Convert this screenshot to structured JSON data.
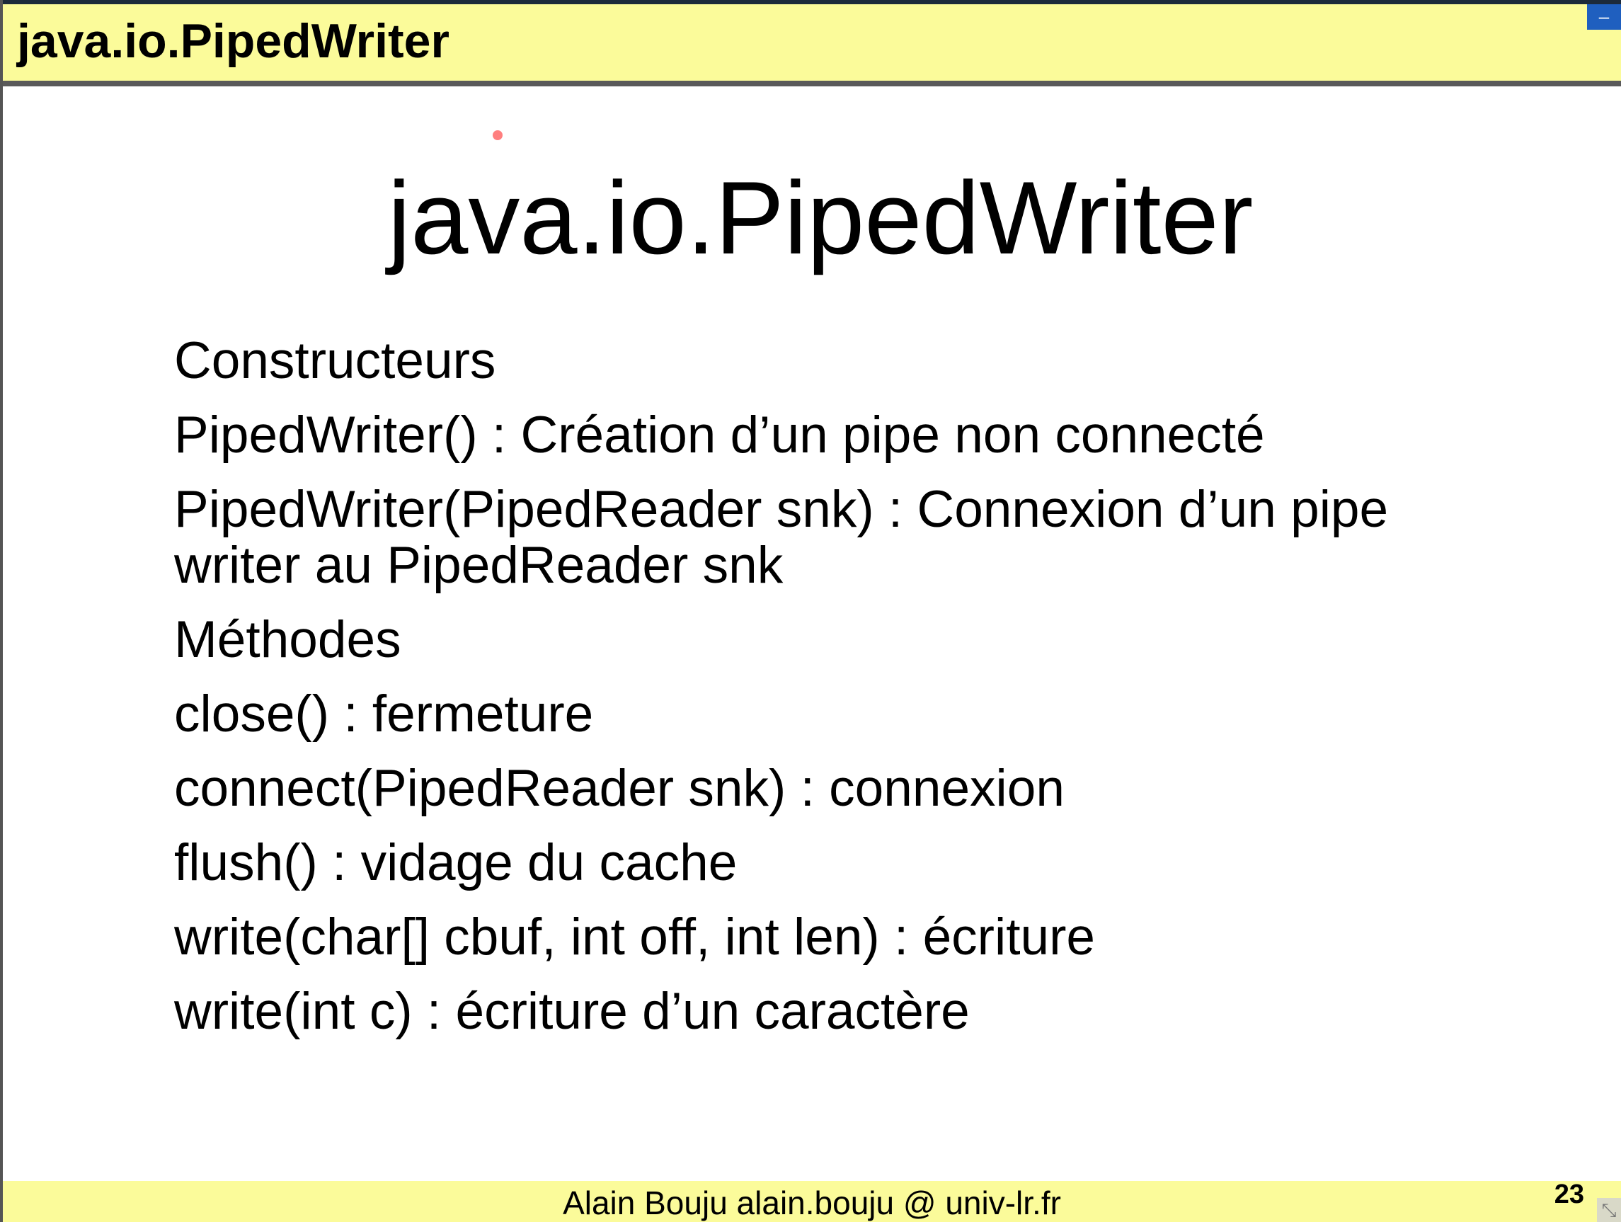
{
  "header": {
    "title": "java.io.PipedWriter"
  },
  "controls": {
    "minimize_label": "–"
  },
  "slide": {
    "title": "java.io.PipedWriter",
    "lines": [
      "Constructeurs",
      "PipedWriter() : Création d’un pipe non connecté",
      "PipedWriter(PipedReader snk) : Connexion d’un pipe writer au PipedReader snk",
      "Méthodes",
      "close() : fermeture",
      "connect(PipedReader snk) : connexion",
      "flush() : vidage du cache",
      "write(char[] cbuf, int off, int len) : écriture",
      "write(int c) : écriture d’un caractère"
    ]
  },
  "footer": {
    "author": "Alain Bouju alain.bouju @ univ-lr.fr",
    "page_number": "23"
  },
  "colors": {
    "header_bg": "#fbfb9a",
    "button_blue": "#1f5fbf",
    "laser_dot": "#ff7f7f"
  }
}
